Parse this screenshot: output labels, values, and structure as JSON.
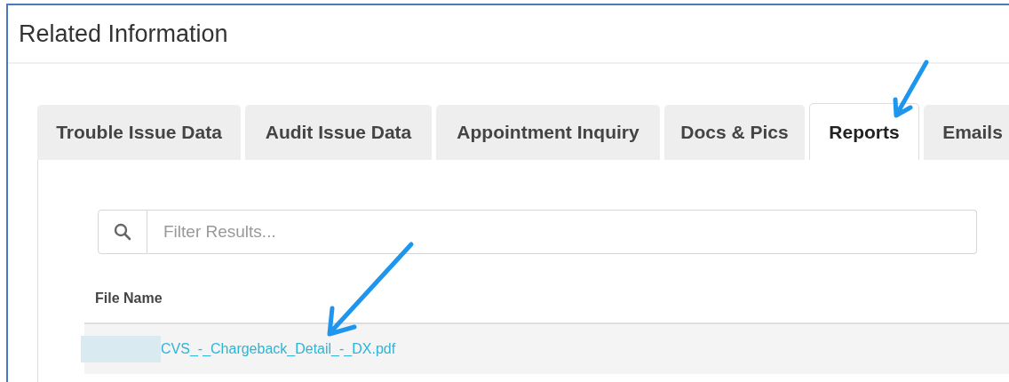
{
  "panel": {
    "title": "Related Information"
  },
  "tabs": [
    {
      "label": "Trouble Issue Data",
      "selected": false
    },
    {
      "label": "Audit Issue Data",
      "selected": false
    },
    {
      "label": "Appointment Inquiry",
      "selected": false
    },
    {
      "label": "Docs & Pics",
      "selected": false
    },
    {
      "label": "Reports",
      "selected": true
    },
    {
      "label": "Emails",
      "selected": false
    }
  ],
  "search": {
    "placeholder": "Filter Results..."
  },
  "table": {
    "columns": [
      "File Name"
    ],
    "rows": [
      {
        "file_name": "CVS_-_Chargeback_Detail_-_DX.pdf",
        "redacted_prefix": true
      }
    ]
  }
}
